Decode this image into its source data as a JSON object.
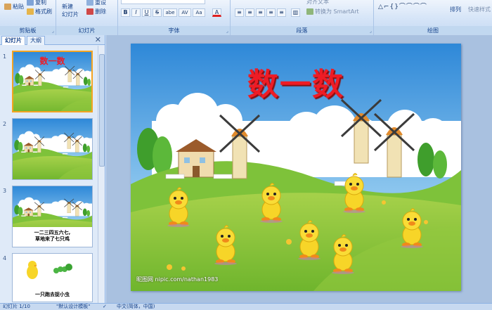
{
  "ribbon": {
    "clipboard": {
      "paste": "粘贴",
      "copy": "复制",
      "format_painter": "格式刷",
      "label": "剪贴板"
    },
    "slides": {
      "new_slide": "新建",
      "new_slide_2": "幻灯片",
      "reset": "重设",
      "delete": "删除",
      "label": "幻灯片"
    },
    "font": {
      "label": "字体",
      "bold": "B",
      "italic": "I",
      "underline": "U",
      "strike": "S",
      "shadow": "abe",
      "spacing": "AV",
      "case": "Aa",
      "color": "A"
    },
    "paragraph": {
      "text_direction": "对齐文本",
      "smartart": "转换为 SmartArt",
      "label": "段落"
    },
    "drawing": {
      "arrange": "排列",
      "quick_styles": "快速样式",
      "label": "绘图"
    }
  },
  "outline_panel": {
    "tabs": [
      "幻灯片",
      "大纲"
    ],
    "thumbnails": [
      {
        "num": "1",
        "title": "数一数",
        "caption": ""
      },
      {
        "num": "2",
        "title": "",
        "caption": ""
      },
      {
        "num": "3",
        "title": "",
        "caption": "一二三四五六七,\n草地来了七只鸡"
      },
      {
        "num": "4",
        "title": "",
        "caption": "一只跑去捉小虫"
      }
    ]
  },
  "slide": {
    "title": "数一数",
    "watermark": "昵图网 nipic.com/nathan1983"
  },
  "status_bar": {
    "slide_count": "幻灯片 1/10",
    "theme": "\"默认设计模板\"",
    "language": "中文(简体，中国)"
  },
  "colors": {
    "title_red": "#ee1c25",
    "ribbon_bg": "#d3e3f7",
    "selection_orange": "#f4a422"
  }
}
